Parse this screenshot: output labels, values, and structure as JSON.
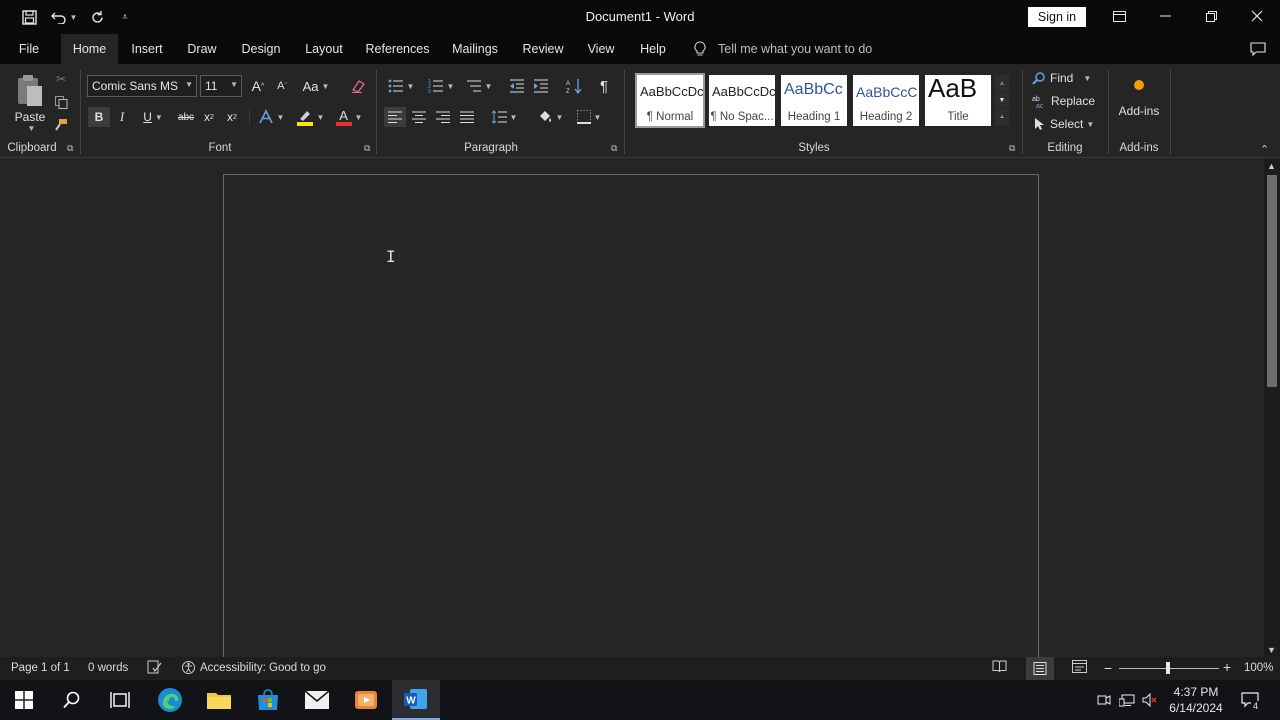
{
  "window": {
    "title": "Document1  -  Word",
    "sign_in": "Sign in"
  },
  "tabs": [
    "File",
    "Home",
    "Insert",
    "Draw",
    "Design",
    "Layout",
    "References",
    "Mailings",
    "Review",
    "View",
    "Help"
  ],
  "active_tab": "Home",
  "tell_me": "Tell me what you want to do",
  "ribbon": {
    "clipboard": {
      "label": "Clipboard",
      "paste": "Paste"
    },
    "font": {
      "label": "Font",
      "font_name": "Comic Sans MS",
      "font_size": "11",
      "bold": "B",
      "italic": "I",
      "underline": "U",
      "strikethrough": "abc",
      "subscript": "x",
      "superscript": "x",
      "change_case": "Aa",
      "grow": "A",
      "shrink": "A",
      "font_color": "A"
    },
    "paragraph": {
      "label": "Paragraph",
      "pilcrow": "¶"
    },
    "styles": {
      "label": "Styles",
      "items": [
        {
          "sample": "AaBbCcDc",
          "name": "¶ Normal"
        },
        {
          "sample": "AaBbCcDc",
          "name": "¶ No Spac..."
        },
        {
          "sample": "AaBbCc",
          "name": "Heading 1"
        },
        {
          "sample": "AaBbCcC",
          "name": "Heading 2"
        },
        {
          "sample": "AaB",
          "name": "Title"
        }
      ]
    },
    "editing": {
      "label": "Editing",
      "find": "Find",
      "replace": "Replace",
      "select": "Select"
    },
    "addins": {
      "label": "Add-ins",
      "button": "Add-ins"
    }
  },
  "status": {
    "page": "Page 1 of 1",
    "words": "0 words",
    "accessibility": "Accessibility: Good to go",
    "zoom": "100%"
  },
  "taskbar": {
    "time": "4:37 PM",
    "date": "6/14/2024",
    "notifications": "4"
  },
  "colors": {
    "accent_word": "#2b579a",
    "highlight": "#ffe600",
    "font_color": "#e8312a"
  }
}
